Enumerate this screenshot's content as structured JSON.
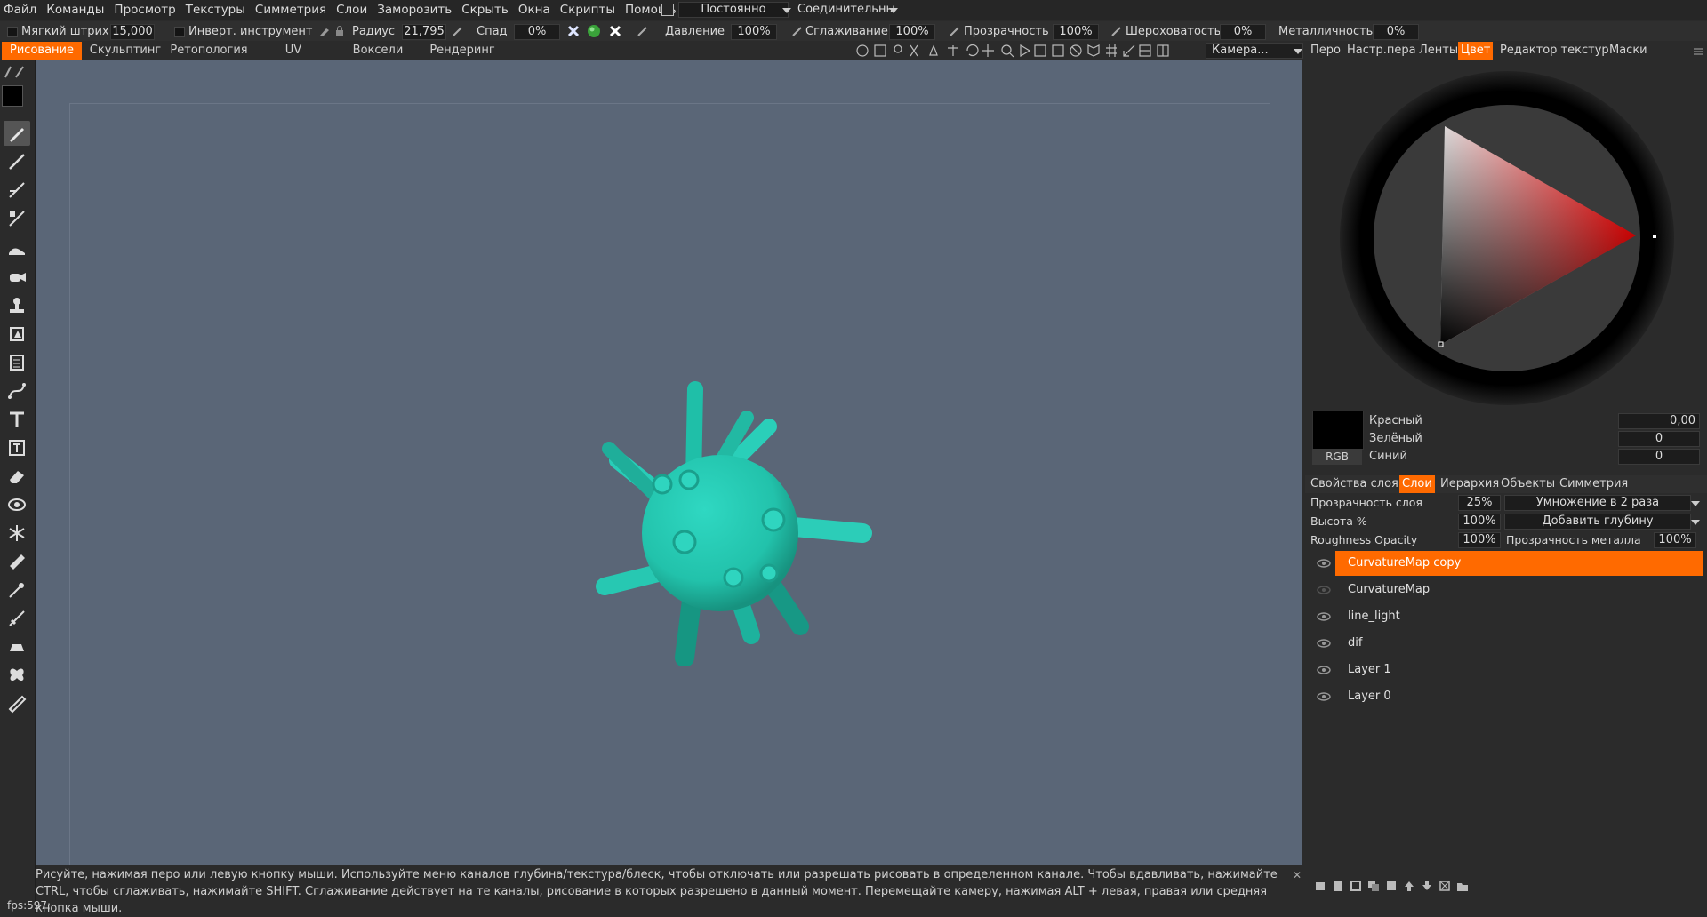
{
  "menu": [
    "Файл",
    "Команды",
    "Просмотр",
    "Текстуры",
    "Симметрия",
    "Слои",
    "Заморозить",
    "Скрыть",
    "Окна",
    "Скрипты",
    "Помощь"
  ],
  "menubar_controls": {
    "mode_value": "Постоянно",
    "snap_value": "Соединительны"
  },
  "toolopts": {
    "soft_stroke_label": "Мягкий штрих",
    "soft_stroke_value": "15,000",
    "invert_label": "Инверт. инструмент",
    "radius_label": "Радиус",
    "radius_value": "21,795",
    "falloff_label": "Спад",
    "falloff_value": "0%",
    "pressure_label": "Давление",
    "pressure_value": "100%",
    "smoothing_label": "Сглаживание",
    "smoothing_value": "100%",
    "opacity_label": "Прозрачность",
    "opacity_value": "100%",
    "roughness_label": "Шероховатость",
    "roughness_value": "0%",
    "metalness_label": "Металличность",
    "metalness_value": "0%"
  },
  "rooms": [
    {
      "label": "Рисование",
      "active": true
    },
    {
      "label": "Скульптинг",
      "active": false
    },
    {
      "label": "Ретопология",
      "active": false
    },
    {
      "label": "UV",
      "active": false
    },
    {
      "label": "Воксели",
      "active": false
    },
    {
      "label": "Рендеринг",
      "active": false
    }
  ],
  "camera_label": "Камера...",
  "right_tabs": [
    "Перо",
    "Настр.пера",
    "Ленты",
    "Цвет",
    "Редактор текстур",
    "Маски"
  ],
  "right_tabs_active": "Цвет",
  "color": {
    "mode_label": "RGB",
    "red_label": "Красный",
    "red_value": "0,00",
    "green_label": "Зелёный",
    "green_value": "0",
    "blue_label": "Синий",
    "blue_value": "0",
    "hue_hex": "#ff0000"
  },
  "layer_tabs": [
    "Свойства слоя",
    "Слои",
    "Иерархия",
    "Объекты",
    "Симметрия"
  ],
  "layer_tabs_active": "Слои",
  "layer_props": {
    "layer_opacity_label": "Прозрачность слоя",
    "layer_opacity_value": "25%",
    "blend_mode": "Умножение в 2 раза",
    "height_label": "Высота %",
    "height_value": "100%",
    "depth_mode": "Добавить глубину",
    "roughness_opacity_label": "Roughness Opacity",
    "roughness_opacity_value": "100%",
    "metal_opacity_label": "Прозрачность металла",
    "metal_opacity_value": "100%"
  },
  "layers": [
    {
      "name": "CurvatureMap copy",
      "selected": true
    },
    {
      "name": "CurvatureMap",
      "selected": false
    },
    {
      "name": "line_light",
      "selected": false
    },
    {
      "name": "dif",
      "selected": false
    },
    {
      "name": "Layer 1",
      "selected": false
    },
    {
      "name": "Layer 0",
      "selected": false
    }
  ],
  "status_text": "Рисуйте, нажимая перо или левую кнопку мыши. Используйте меню каналов глубина/текстура/блеск, чтобы отключать или разрешать рисовать в определенном канале. Чтобы вдавливать, нажимайте CTRL, чтобы сглаживать, нажимайте SHIFT. Сглаживание действует на те каналы, рисование в которых разрешено в данный момент. Перемещайте камеру, нажимая ALT + левая, правая или средняя кнопка мыши.",
  "fps_label": "fps:597;",
  "accent_color": "#ff6a00",
  "model_color": "#22c7b0"
}
